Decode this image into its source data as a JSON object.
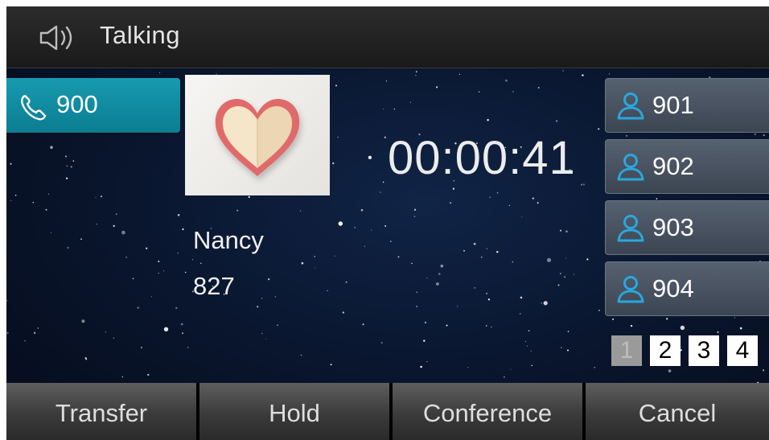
{
  "header": {
    "title": "Talking",
    "icon": "speaker-icon"
  },
  "line_key": {
    "label": "900",
    "icon": "handset-icon",
    "color": "#0f8ca1"
  },
  "caller": {
    "name": "Nancy",
    "number": "827",
    "avatar_icon": "heart-icon"
  },
  "call": {
    "duration": "00:00:41"
  },
  "contacts": [
    {
      "label": "901",
      "icon": "person-icon"
    },
    {
      "label": "902",
      "icon": "person-icon"
    },
    {
      "label": "903",
      "icon": "person-icon"
    },
    {
      "label": "904",
      "icon": "person-icon"
    }
  ],
  "pages": {
    "items": [
      "1",
      "2",
      "3",
      "4"
    ],
    "current": "1"
  },
  "softkeys": {
    "transfer": "Transfer",
    "hold": "Hold",
    "conference": "Conference",
    "cancel": "Cancel"
  },
  "colors": {
    "accent": "#0f8ca1",
    "person_icon": "#2aa7dc",
    "heart": "#e06a6a",
    "heart_fill": "#f1dfc2"
  }
}
